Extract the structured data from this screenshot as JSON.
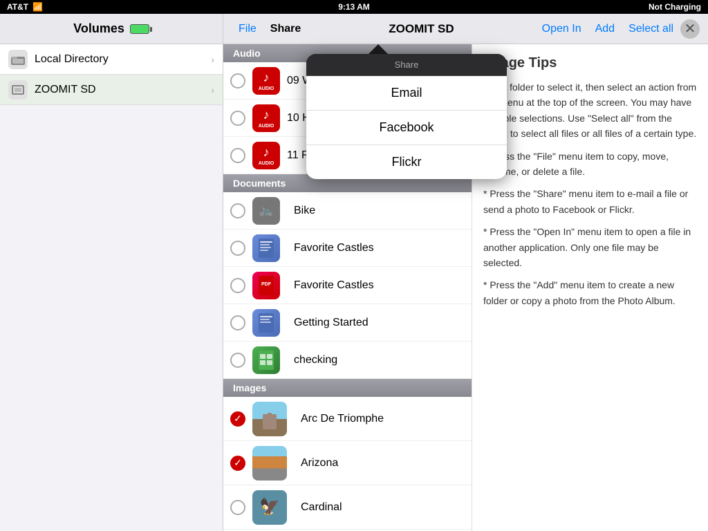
{
  "statusBar": {
    "carrier": "AT&T",
    "time": "9:13 AM",
    "batteryStatus": "Not Charging"
  },
  "sidebar": {
    "title": "Volumes",
    "items": [
      {
        "id": "local-directory",
        "label": "Local Directory",
        "active": false
      },
      {
        "id": "zoomit-sd",
        "label": "ZOOMIT SD",
        "active": true
      }
    ]
  },
  "toolbar": {
    "title": "ZOOMIT SD",
    "buttons": {
      "file": "File",
      "share": "Share",
      "openIn": "Open In",
      "add": "Add",
      "selectAll": "Select all"
    }
  },
  "sections": {
    "audio": {
      "label": "Audio",
      "items": [
        {
          "id": "audio-09",
          "name": "09 When You N...",
          "checked": false
        },
        {
          "id": "audio-10",
          "name": "10 Had To Make...",
          "checked": false
        },
        {
          "id": "audio-11",
          "name": "11 Rock 'n' Roll T...",
          "checked": false
        }
      ]
    },
    "documents": {
      "label": "Documents",
      "items": [
        {
          "id": "doc-bike",
          "name": "Bike",
          "type": "pages",
          "checked": false
        },
        {
          "id": "doc-favcastles1",
          "name": "Favorite Castles",
          "type": "pages",
          "checked": false
        },
        {
          "id": "doc-favcastles2",
          "name": "Favorite Castles",
          "type": "pdf",
          "checked": false
        },
        {
          "id": "doc-gettingstarted",
          "name": "Getting Started",
          "type": "pages",
          "checked": false
        },
        {
          "id": "doc-checking",
          "name": "checking",
          "type": "numbers",
          "checked": false
        }
      ]
    },
    "images": {
      "label": "Images",
      "items": [
        {
          "id": "img-arc",
          "name": "Arc De Triomphe",
          "checked": true
        },
        {
          "id": "img-arizona",
          "name": "Arizona",
          "checked": true
        },
        {
          "id": "img-cardinal",
          "name": "Cardinal",
          "checked": false
        }
      ]
    }
  },
  "usagePanel": {
    "title": "Usage Tips",
    "paragraphs": [
      "Tap a folder to select it, then select an action from the menu at the top of the screen.  You may have multiple selections.  Use \"Select all\" from the menu to select all files or all files of a certain type.",
      "* Press the \"File\" menu item to copy, move, rename, or delete a file.",
      "* Press the \"Share\" menu item to e-mail a file or send a photo to Facebook or Flickr.",
      "* Press the \"Open In\" menu item to open a file in another application.  Only one file may be selected.",
      "* Press the \"Add\" menu item to create a new folder or copy a photo from the Photo Album."
    ]
  },
  "sharePopup": {
    "header": "Share",
    "options": [
      {
        "id": "email",
        "label": "Email"
      },
      {
        "id": "facebook",
        "label": "Facebook"
      },
      {
        "id": "flickr",
        "label": "Flickr"
      }
    ]
  }
}
